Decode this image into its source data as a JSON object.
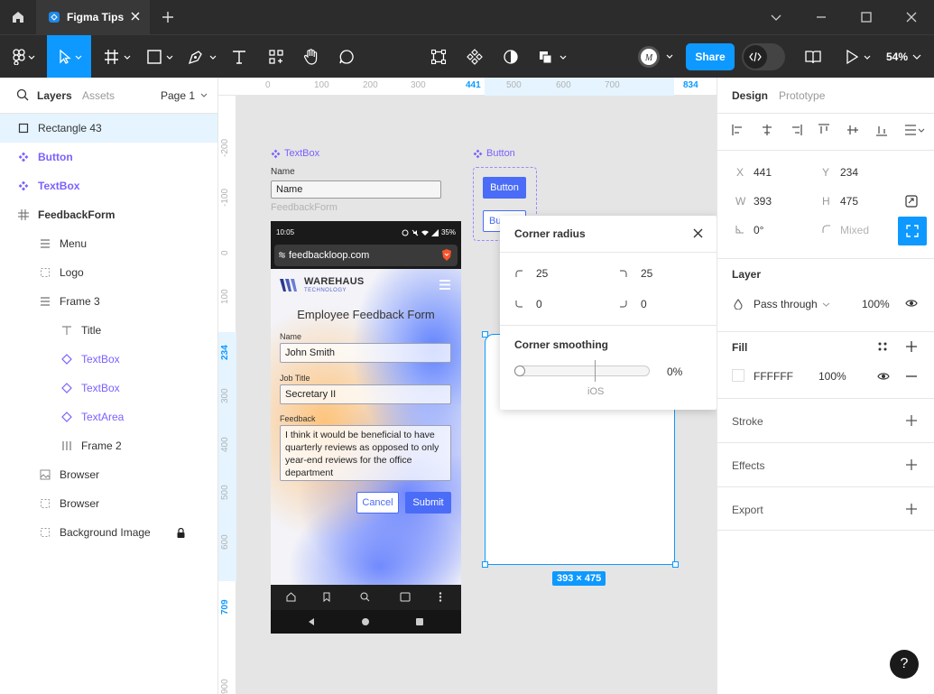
{
  "window": {
    "tab_title": "Figma Tips"
  },
  "toolbar": {
    "share_label": "Share",
    "zoom_label": "54%"
  },
  "left_panel": {
    "tabs": {
      "layers": "Layers",
      "assets": "Assets"
    },
    "page_selector": "Page 1",
    "layers": [
      {
        "name": "Rectangle 43",
        "icon": "rectangle-icon",
        "indent": 0,
        "selected": true,
        "kind": "plain"
      },
      {
        "name": "Button",
        "icon": "component-icon",
        "indent": 0,
        "kind": "component"
      },
      {
        "name": "TextBox",
        "icon": "component-icon",
        "indent": 0,
        "kind": "component"
      },
      {
        "name": "FeedbackForm",
        "icon": "frame-icon",
        "indent": 0,
        "kind": "frame"
      },
      {
        "name": "Menu",
        "icon": "auto-layout-vertical-icon",
        "indent": 1,
        "kind": "plain"
      },
      {
        "name": "Logo",
        "icon": "dashed-frame-icon",
        "indent": 1,
        "kind": "plain"
      },
      {
        "name": "Frame 3",
        "icon": "auto-layout-vertical-icon",
        "indent": 1,
        "kind": "plain"
      },
      {
        "name": "Title",
        "icon": "text-icon",
        "indent": 2,
        "kind": "plain"
      },
      {
        "name": "TextBox",
        "icon": "instance-icon",
        "indent": 2,
        "kind": "component"
      },
      {
        "name": "TextBox",
        "icon": "instance-icon",
        "indent": 2,
        "kind": "component"
      },
      {
        "name": "TextArea",
        "icon": "instance-icon",
        "indent": 2,
        "kind": "component"
      },
      {
        "name": "Frame 2",
        "icon": "auto-layout-horizontal-icon",
        "indent": 2,
        "kind": "plain"
      },
      {
        "name": "Browser",
        "icon": "image-icon",
        "indent": 1,
        "kind": "plain"
      },
      {
        "name": "Browser",
        "icon": "dashed-frame-icon",
        "indent": 1,
        "kind": "plain"
      },
      {
        "name": "Background Image",
        "icon": "dashed-frame-icon",
        "indent": 1,
        "kind": "plain",
        "locked": true
      }
    ]
  },
  "canvas": {
    "ruler_top": [
      "0",
      "100",
      "200",
      "300",
      "441",
      "500",
      "600",
      "700",
      "834"
    ],
    "ruler_left": [
      "-200",
      "-100",
      "0",
      "100",
      "234",
      "300",
      "400",
      "500",
      "600",
      "709",
      "900"
    ],
    "textbox_component": {
      "title": "TextBox",
      "label": "Name",
      "value": "Name"
    },
    "button_component": {
      "title": "Button",
      "label": "Button",
      "label2": "Bu"
    },
    "frame_label": "FeedbackForm",
    "phone": {
      "time": "10:05",
      "battery": "35%",
      "url": "feedbackloop.com",
      "brand": "WAREHAUS",
      "brand_sub": "TECHNOLOGY",
      "heading": "Employee Feedback Form",
      "fields": [
        {
          "label": "Name",
          "value": "John Smith"
        },
        {
          "label": "Job Title",
          "value": "Secretary II"
        }
      ],
      "feedback_label": "Feedback",
      "feedback_text": "I think it would be beneficial to have quarterly reviews as opposed to only year-end reviews for the office department",
      "cancel": "Cancel",
      "submit": "Submit"
    },
    "selection_size": "393 × 475"
  },
  "corner_popup": {
    "title": "Corner radius",
    "top_left": "25",
    "top_right": "25",
    "bottom_left": "0",
    "bottom_right": "0",
    "smoothing_title": "Corner smoothing",
    "smoothing_value": "0%",
    "smoothing_fraction": 0.0,
    "ios_label": "iOS"
  },
  "right_panel": {
    "tabs": {
      "design": "Design",
      "prototype": "Prototype"
    },
    "x_label": "X",
    "x_value": "441",
    "y_label": "Y",
    "y_value": "234",
    "w_label": "W",
    "w_value": "393",
    "h_label": "H",
    "h_value": "475",
    "rotation": "0°",
    "radius_value": "Mixed",
    "layer_title": "Layer",
    "blend_mode": "Pass through",
    "layer_opacity": "100%",
    "fill_title": "Fill",
    "fill_hex": "FFFFFF",
    "fill_opacity": "100%",
    "stroke_title": "Stroke",
    "effects_title": "Effects",
    "export_title": "Export"
  },
  "help": "?",
  "colors": {
    "accent": "#0d99ff",
    "component": "#7b61ff",
    "dark_bar": "#2c2c2c",
    "submit_blue": "#4a6cf7"
  }
}
